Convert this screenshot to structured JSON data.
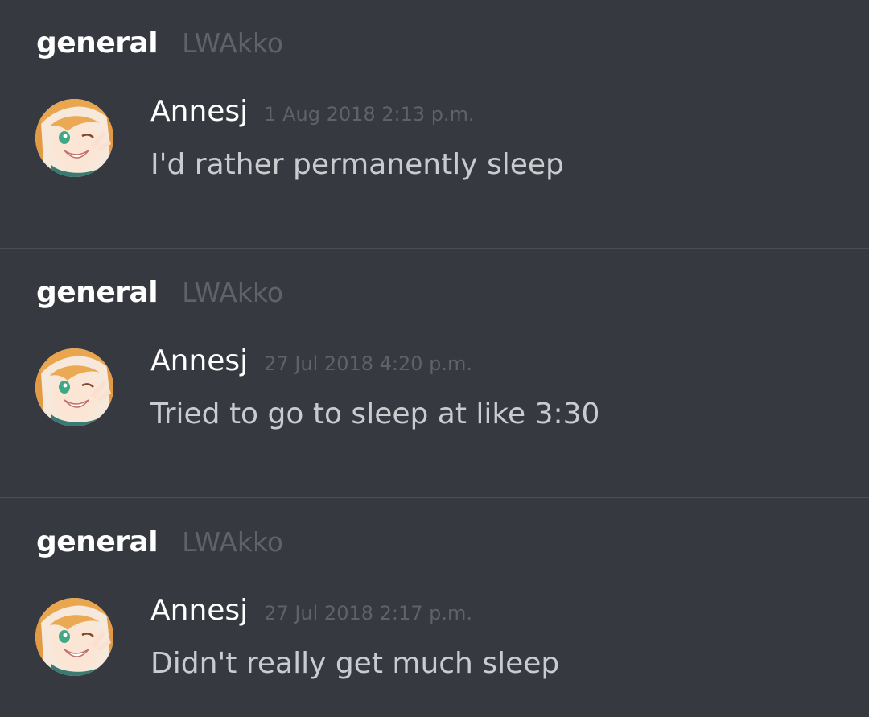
{
  "results": [
    {
      "channel": "general",
      "server": "LWAkko",
      "author": "Annesj",
      "timestamp": "1 Aug 2018 2:13 p.m.",
      "message": "I'd rather permanently sleep"
    },
    {
      "channel": "general",
      "server": "LWAkko",
      "author": "Annesj",
      "timestamp": "27 Jul 2018 4:20 p.m.",
      "message": "Tried to go to sleep at like 3:30"
    },
    {
      "channel": "general",
      "server": "LWAkko",
      "author": "Annesj",
      "timestamp": "27 Jul 2018 2:17 p.m.",
      "message": "Didn't really get much sleep"
    }
  ],
  "colors": {
    "background": "#36393f",
    "divider": "#4a4d54",
    "channel": "#ffffff",
    "muted": "#5f6268",
    "message": "#c9cbce"
  }
}
